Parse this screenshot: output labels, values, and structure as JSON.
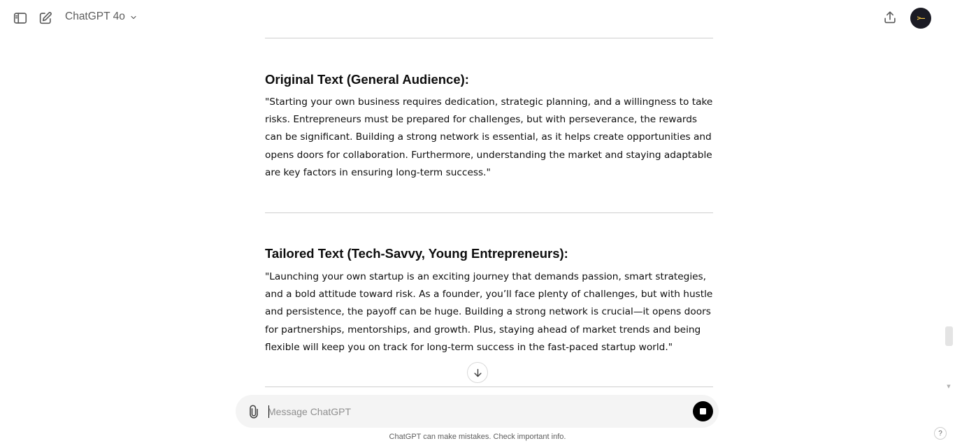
{
  "header": {
    "model_name": "ChatGPT 4o",
    "icons": {
      "sidebar": "sidebar-toggle-icon",
      "new_chat": "new-chat-icon",
      "model_dropdown": "chevron-down-icon",
      "share": "share-icon"
    },
    "avatar_text": ">—"
  },
  "message": {
    "sections": [
      {
        "heading": "Original Text (General Audience):",
        "text": "\"Starting your own business requires dedication, strategic planning, and a willingness to take risks. Entrepreneurs must be prepared for challenges, but with perseverance, the rewards can be significant. Building a strong network is essential, as it helps create opportunities and opens doors for collaboration. Furthermore, understanding the market and staying adaptable are key factors in ensuring long-term success.\""
      },
      {
        "heading": "Tailored Text (Tech-Savvy, Young Entrepreneurs):",
        "text": "\"Launching your own startup is an exciting journey that demands passion, smart strategies, and a bold attitude toward risk. As a founder, you’ll face plenty of challenges, but with hustle and persistence, the payoff can be huge. Building a strong network is crucial—it opens doors for partnerships, mentorships, and growth. Plus, staying ahead of market trends and being flexible will keep you on track for long-term success in the fast-paced startup world.\""
      }
    ]
  },
  "composer": {
    "placeholder": "Message ChatGPT",
    "value": "",
    "attach_icon": "paperclip-icon",
    "stop_icon": "stop-icon"
  },
  "footer": {
    "disclaimer": "ChatGPT can make mistakes. Check important info.",
    "help_label": "?"
  },
  "colors": {
    "background": "#ffffff",
    "composer_bg": "#f4f4f4",
    "divider": "#cfcfcf",
    "text": "#0d0d0d",
    "muted": "#5d5d5d",
    "avatar_bg": "#1b1b24",
    "avatar_fg": "#f5c542"
  }
}
